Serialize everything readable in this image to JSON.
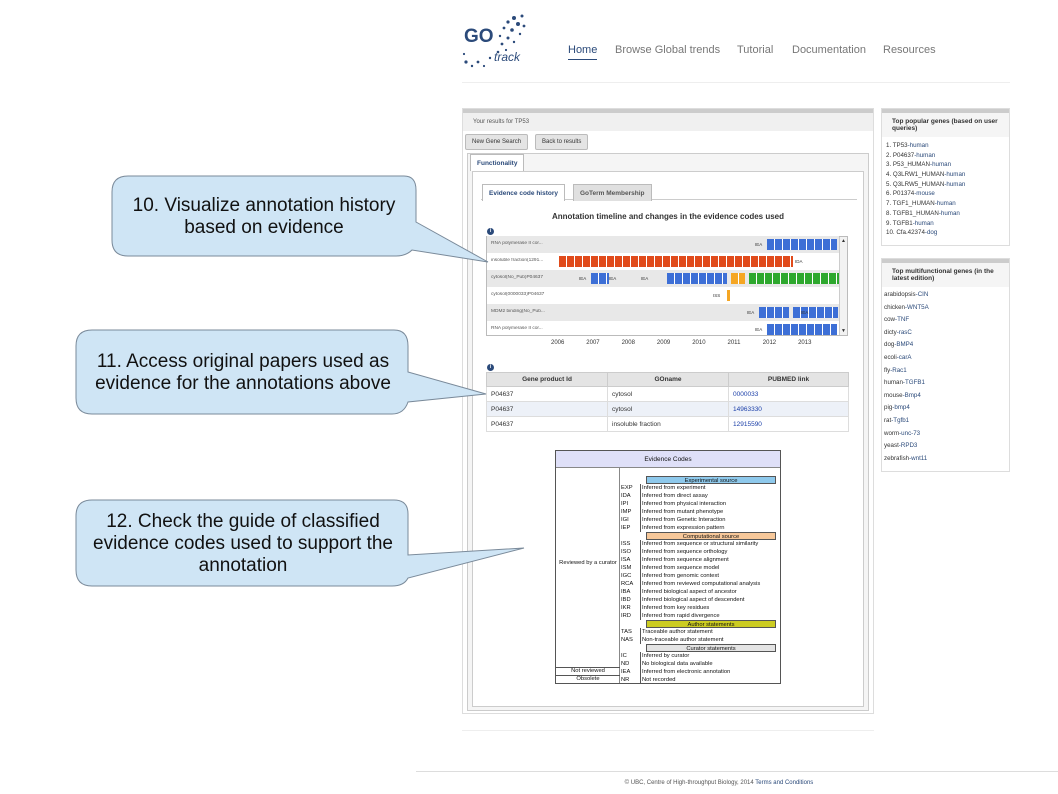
{
  "header": {
    "logo_text_top": "GO",
    "logo_text_bottom": "track",
    "nav": [
      "Home",
      "Browse Global trends",
      "Tutorial",
      "Documentation",
      "Resources"
    ]
  },
  "main": {
    "results_label": "Your results for TP53",
    "buttons": [
      "New Gene Search",
      "Back to results"
    ],
    "tab_functionality": "Functionality",
    "inner_tabs": [
      "Evidence code history",
      "GoTerm Membership"
    ],
    "timeline_title": "Annotation timeline and changes in the evidence codes used",
    "timeline_rows": [
      {
        "label": "RNA polymerase II cor...",
        "tags": [
          "IEA"
        ]
      },
      {
        "label": "insoluble fraction(1291...",
        "tags": [
          "IDA"
        ]
      },
      {
        "label": "cytosol(No_Pub)P04637",
        "tags": [
          "IEA",
          "IEA",
          "IEA"
        ]
      },
      {
        "label": "cytosol(0000033)P04637",
        "tags": [
          "ISS"
        ]
      },
      {
        "label": "MDM2 binding(No_Pub...",
        "tags": [
          "IEA",
          "IEA"
        ]
      },
      {
        "label": "RNA polymerase II cor...",
        "tags": [
          "IEA"
        ]
      }
    ],
    "years": [
      "2006",
      "2007",
      "2008",
      "2009",
      "2010",
      "2011",
      "2012",
      "2013"
    ],
    "table": {
      "headers": [
        "Gene product Id",
        "GOname",
        "PUBMED link"
      ],
      "rows": [
        [
          "P04637",
          "cytosol",
          "0000033"
        ],
        [
          "P04637",
          "cytosol",
          "14963330"
        ],
        [
          "P04637",
          "insoluble fraction",
          "12915590"
        ]
      ]
    }
  },
  "evidence_codes": {
    "title": "Evidence Codes",
    "groups": [
      "Reviewed by a curator",
      "Not reviewed",
      "Obsolete"
    ],
    "sections": {
      "experimental": "Experimental source",
      "computational": "Computational source",
      "author": "Author statements",
      "curator": "Curator statements"
    },
    "experimental": [
      [
        "EXP",
        "Inferred from experiment"
      ],
      [
        "IDA",
        "Inferred from direct assay"
      ],
      [
        "IPI",
        "Inferred from physical interaction"
      ],
      [
        "IMP",
        "Inferred from mutant phenotype"
      ],
      [
        "IGI",
        "Inferred from Genetic Interaction"
      ],
      [
        "IEP",
        "Inferred from expression pattern"
      ]
    ],
    "computational": [
      [
        "ISS",
        "Inferred from sequence or structural similarity"
      ],
      [
        "ISO",
        "Inferred from sequence orthology"
      ],
      [
        "ISA",
        "Inferred from sequence alignment"
      ],
      [
        "ISM",
        "Inferred from sequence model"
      ],
      [
        "IGC",
        "Inferred from genomic context"
      ],
      [
        "RCA",
        "Inferred from reviewed computational analysis"
      ],
      [
        "IBA",
        "Inferred biological aspect of ancestor"
      ],
      [
        "IBD",
        "Inferred biological aspect of descendent"
      ],
      [
        "IKR",
        "Inferred from key residues"
      ],
      [
        "IRD",
        "Inferred from rapid divergence"
      ]
    ],
    "author": [
      [
        "TAS",
        "Traceable author statement"
      ],
      [
        "NAS",
        "Non-traceable author statement"
      ]
    ],
    "curator": [
      [
        "IC",
        "Inferred by curator"
      ],
      [
        "ND",
        "No biological data available"
      ]
    ],
    "not_reviewed": [
      "IEA",
      "Inferred from electronic annotation"
    ],
    "obsolete": [
      "NR",
      "Not recorded"
    ]
  },
  "sidebar_popular": {
    "title": "Top popular genes (based on user queries)",
    "items": [
      [
        "TP53",
        "-human"
      ],
      [
        "P04637",
        "-human"
      ],
      [
        "P53_HUMAN",
        "-human"
      ],
      [
        "Q3LRW1_HUMAN",
        "-human"
      ],
      [
        "Q3LRW5_HUMAN",
        "-human"
      ],
      [
        "P01374",
        "-mouse"
      ],
      [
        "TGF1_HUMAN",
        "-human"
      ],
      [
        "TGFB1_HUMAN",
        "-human"
      ],
      [
        "TGFB1",
        "-human"
      ],
      [
        "Cfa.42374",
        "-dog"
      ]
    ]
  },
  "sidebar_multifunctional": {
    "title": "Top multifunctional genes (in the latest edition)",
    "items": [
      [
        "arabidopsis",
        "-CIN"
      ],
      [
        "chicken",
        "-WNT5A"
      ],
      [
        "cow",
        "-TNF"
      ],
      [
        "dicty",
        "-rasC"
      ],
      [
        "dog",
        "-BMP4"
      ],
      [
        "ecoli",
        "-carA"
      ],
      [
        "fly",
        "-Rac1"
      ],
      [
        "human",
        "-TGFB1"
      ],
      [
        "mouse",
        "-Bmp4"
      ],
      [
        "pig",
        "-bmp4"
      ],
      [
        "rat",
        "-Tgfb1"
      ],
      [
        "worm",
        "-unc-73"
      ],
      [
        "yeast",
        "-RPD3"
      ],
      [
        "zebrafish",
        "-wnt11"
      ]
    ]
  },
  "callouts": [
    "10. Visualize annotation history based on evidence",
    "11. Access original papers used as evidence for the annotations above",
    "12. Check the guide of classified evidence codes used to support the annotation"
  ],
  "footer": {
    "text": "© UBC, Centre of High-throughput Biology, 2014",
    "link": "Terms and Conditions"
  },
  "colors": {
    "iea": "#3d6fd6",
    "ida": "#e04a1a",
    "iss": "#f5a623",
    "tas": "#2ea82e",
    "callout_fill": "#cfe5f5",
    "nav_active": "#2b4a7a"
  }
}
